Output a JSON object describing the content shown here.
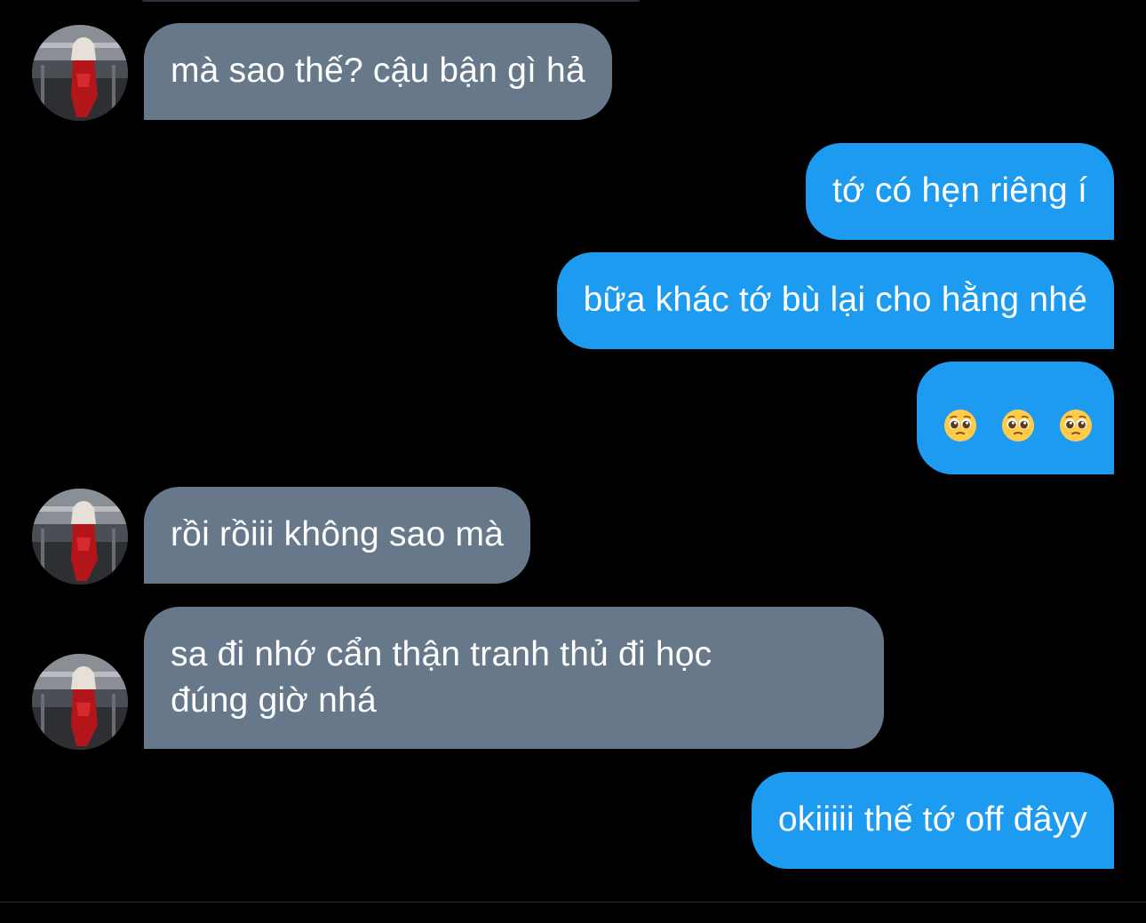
{
  "thread": {
    "messages": [
      {
        "from": "other",
        "lines": [
          "mà sao thế? cậu bận gì hả"
        ]
      },
      {
        "from": "me",
        "lines": [
          "tớ có hẹn riêng í"
        ]
      },
      {
        "from": "me",
        "lines": [
          "bữa khác tớ bù lại cho hằng nhé"
        ]
      },
      {
        "from": "me",
        "emoji": [
          "pleading-face-icon",
          "pleading-face-icon",
          "pleading-face-icon"
        ]
      },
      {
        "from": "other",
        "lines": [
          "rồi rồiii không sao mà"
        ]
      },
      {
        "from": "other",
        "lines": [
          "sa đi nhớ cẩn thận tranh thủ đi học",
          "đúng giờ nhá"
        ]
      },
      {
        "from": "me",
        "lines": [
          "okiiiii thế tớ off đâyy"
        ]
      }
    ]
  },
  "colors": {
    "background": "#000000",
    "incoming_bubble": "#66788a",
    "outgoing_bubble": "#1d9bf0",
    "text": "#ffffff"
  }
}
